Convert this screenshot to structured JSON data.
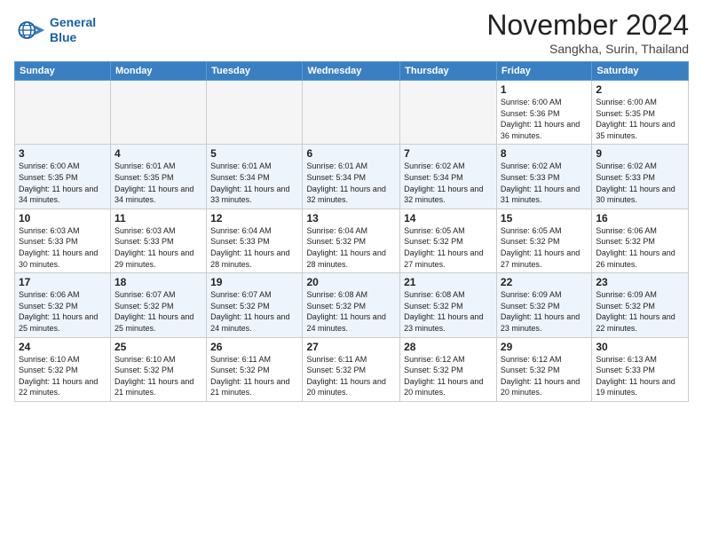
{
  "header": {
    "logo_line1": "General",
    "logo_line2": "Blue",
    "month": "November 2024",
    "location": "Sangkha, Surin, Thailand"
  },
  "weekdays": [
    "Sunday",
    "Monday",
    "Tuesday",
    "Wednesday",
    "Thursday",
    "Friday",
    "Saturday"
  ],
  "weeks": [
    [
      {
        "day": "",
        "info": ""
      },
      {
        "day": "",
        "info": ""
      },
      {
        "day": "",
        "info": ""
      },
      {
        "day": "",
        "info": ""
      },
      {
        "day": "",
        "info": ""
      },
      {
        "day": "1",
        "info": "Sunrise: 6:00 AM\nSunset: 5:36 PM\nDaylight: 11 hours and 36 minutes."
      },
      {
        "day": "2",
        "info": "Sunrise: 6:00 AM\nSunset: 5:35 PM\nDaylight: 11 hours and 35 minutes."
      }
    ],
    [
      {
        "day": "3",
        "info": "Sunrise: 6:00 AM\nSunset: 5:35 PM\nDaylight: 11 hours and 34 minutes."
      },
      {
        "day": "4",
        "info": "Sunrise: 6:01 AM\nSunset: 5:35 PM\nDaylight: 11 hours and 34 minutes."
      },
      {
        "day": "5",
        "info": "Sunrise: 6:01 AM\nSunset: 5:34 PM\nDaylight: 11 hours and 33 minutes."
      },
      {
        "day": "6",
        "info": "Sunrise: 6:01 AM\nSunset: 5:34 PM\nDaylight: 11 hours and 32 minutes."
      },
      {
        "day": "7",
        "info": "Sunrise: 6:02 AM\nSunset: 5:34 PM\nDaylight: 11 hours and 32 minutes."
      },
      {
        "day": "8",
        "info": "Sunrise: 6:02 AM\nSunset: 5:33 PM\nDaylight: 11 hours and 31 minutes."
      },
      {
        "day": "9",
        "info": "Sunrise: 6:02 AM\nSunset: 5:33 PM\nDaylight: 11 hours and 30 minutes."
      }
    ],
    [
      {
        "day": "10",
        "info": "Sunrise: 6:03 AM\nSunset: 5:33 PM\nDaylight: 11 hours and 30 minutes."
      },
      {
        "day": "11",
        "info": "Sunrise: 6:03 AM\nSunset: 5:33 PM\nDaylight: 11 hours and 29 minutes."
      },
      {
        "day": "12",
        "info": "Sunrise: 6:04 AM\nSunset: 5:33 PM\nDaylight: 11 hours and 28 minutes."
      },
      {
        "day": "13",
        "info": "Sunrise: 6:04 AM\nSunset: 5:32 PM\nDaylight: 11 hours and 28 minutes."
      },
      {
        "day": "14",
        "info": "Sunrise: 6:05 AM\nSunset: 5:32 PM\nDaylight: 11 hours and 27 minutes."
      },
      {
        "day": "15",
        "info": "Sunrise: 6:05 AM\nSunset: 5:32 PM\nDaylight: 11 hours and 27 minutes."
      },
      {
        "day": "16",
        "info": "Sunrise: 6:06 AM\nSunset: 5:32 PM\nDaylight: 11 hours and 26 minutes."
      }
    ],
    [
      {
        "day": "17",
        "info": "Sunrise: 6:06 AM\nSunset: 5:32 PM\nDaylight: 11 hours and 25 minutes."
      },
      {
        "day": "18",
        "info": "Sunrise: 6:07 AM\nSunset: 5:32 PM\nDaylight: 11 hours and 25 minutes."
      },
      {
        "day": "19",
        "info": "Sunrise: 6:07 AM\nSunset: 5:32 PM\nDaylight: 11 hours and 24 minutes."
      },
      {
        "day": "20",
        "info": "Sunrise: 6:08 AM\nSunset: 5:32 PM\nDaylight: 11 hours and 24 minutes."
      },
      {
        "day": "21",
        "info": "Sunrise: 6:08 AM\nSunset: 5:32 PM\nDaylight: 11 hours and 23 minutes."
      },
      {
        "day": "22",
        "info": "Sunrise: 6:09 AM\nSunset: 5:32 PM\nDaylight: 11 hours and 23 minutes."
      },
      {
        "day": "23",
        "info": "Sunrise: 6:09 AM\nSunset: 5:32 PM\nDaylight: 11 hours and 22 minutes."
      }
    ],
    [
      {
        "day": "24",
        "info": "Sunrise: 6:10 AM\nSunset: 5:32 PM\nDaylight: 11 hours and 22 minutes."
      },
      {
        "day": "25",
        "info": "Sunrise: 6:10 AM\nSunset: 5:32 PM\nDaylight: 11 hours and 21 minutes."
      },
      {
        "day": "26",
        "info": "Sunrise: 6:11 AM\nSunset: 5:32 PM\nDaylight: 11 hours and 21 minutes."
      },
      {
        "day": "27",
        "info": "Sunrise: 6:11 AM\nSunset: 5:32 PM\nDaylight: 11 hours and 20 minutes."
      },
      {
        "day": "28",
        "info": "Sunrise: 6:12 AM\nSunset: 5:32 PM\nDaylight: 11 hours and 20 minutes."
      },
      {
        "day": "29",
        "info": "Sunrise: 6:12 AM\nSunset: 5:32 PM\nDaylight: 11 hours and 20 minutes."
      },
      {
        "day": "30",
        "info": "Sunrise: 6:13 AM\nSunset: 5:33 PM\nDaylight: 11 hours and 19 minutes."
      }
    ]
  ]
}
